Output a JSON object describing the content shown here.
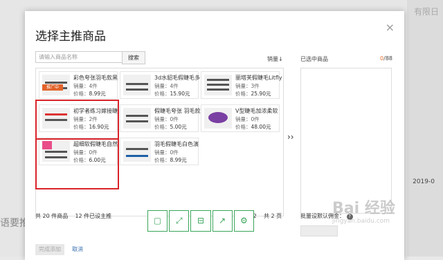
{
  "dialog": {
    "title": "选择主推商品",
    "search_placeholder": "请输入商品名称",
    "search_button": "搜索",
    "sort_label": "销量↓",
    "move_arrow": "››",
    "selected_title": "已选中商品",
    "selected_count": "0",
    "selected_max": "/88",
    "footer_total": "共 20 件商品",
    "footer_set": "12 件已设主推",
    "pager_prev": "‹",
    "pager_page": "2/2",
    "pager_total": "共 2 页",
    "batch_label": "批量设默认佣金：",
    "batch_help": "?",
    "confirm_button": "完成添加",
    "cancel_button": "取消",
    "close_glyph": "×"
  },
  "labels": {
    "sold": "销量：",
    "price": "价格："
  },
  "products": [
    {
      "name": "彩色夸张羽毛款黑",
      "sold": "4件",
      "price": "8.99元",
      "badge": "推广中"
    },
    {
      "name": "3d水貂毛假睫毛多",
      "sold": "4件",
      "price": "15.90元"
    },
    {
      "name": "丽塔芙假睫毛Litfly",
      "sold": "3件",
      "price": "25.90元"
    },
    {
      "name": "初学者练习嫁接睫",
      "sold": "2件",
      "price": "16.90元"
    },
    {
      "name": "假睫毛夸张 羽毛款",
      "sold": "0件",
      "price": "5.00元"
    },
    {
      "name": "V型睫毛加浓柔软",
      "sold": "0件",
      "price": "48.00元"
    },
    {
      "name": "超细软假睫毛自然",
      "sold": "0件",
      "price": "6.00元"
    },
    {
      "name": "羽毛假睫毛白色演",
      "sold": "0件",
      "price": "8.99元"
    }
  ],
  "toolbar": {
    "icons": [
      "crop-icon",
      "fullscreen-icon",
      "save-icon",
      "share-icon",
      "settings-icon"
    ],
    "glyphs": [
      "▢",
      "⤢",
      "⊟",
      "↗",
      "⚙"
    ]
  },
  "background": {
    "date_text": "2019-0",
    "left_text": "语要推,",
    "top_right_text": "有限日"
  },
  "watermark": {
    "brand": "Bai 经验",
    "url": "jingyan.baidu.com"
  }
}
